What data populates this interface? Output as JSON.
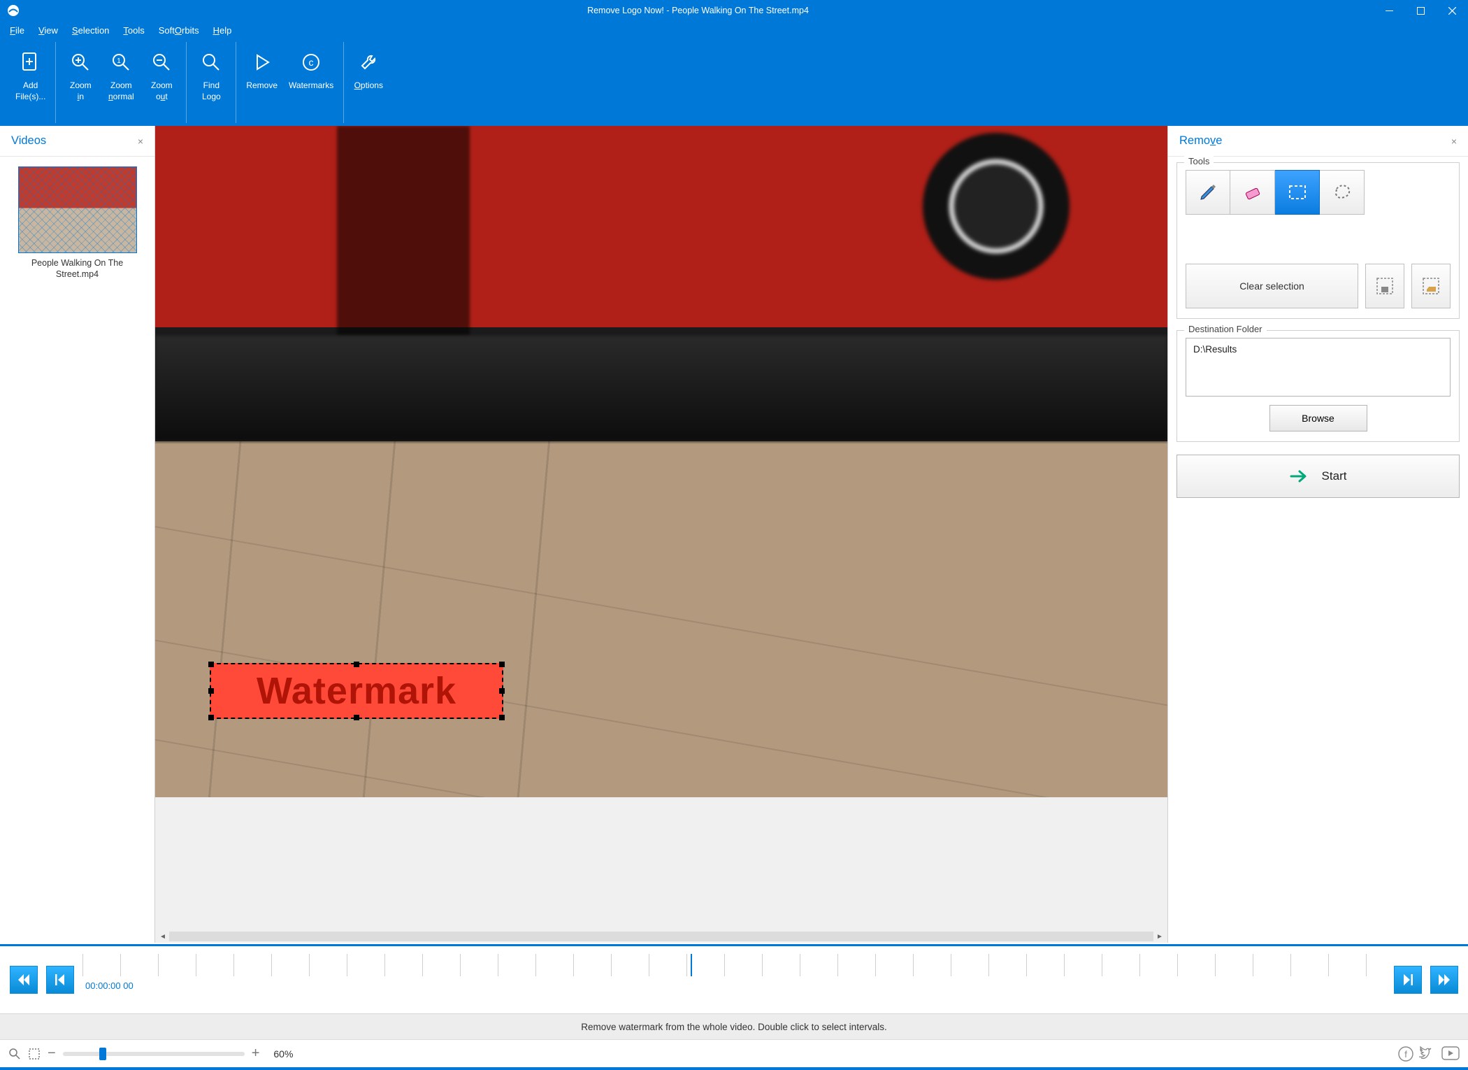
{
  "titlebar": {
    "title": "Remove Logo Now! - People Walking On The Street.mp4"
  },
  "menu": {
    "file": "File",
    "view": "View",
    "selection": "Selection",
    "tools": "Tools",
    "softorbits": "SoftOrbits",
    "help": "Help"
  },
  "ribbon": {
    "add": "Add\nFile(s)...",
    "zoom_in": "Zoom\nin",
    "zoom_normal": "Zoom\nnormal",
    "zoom_out": "Zoom\nout",
    "find_logo": "Find\nLogo",
    "remove": "Remove",
    "watermarks": "Watermarks",
    "options": "Options"
  },
  "left_panel": {
    "title": "Videos",
    "thumb_name": "People Walking On The\nStreet.mp4"
  },
  "canvas": {
    "watermark_text": "Watermark"
  },
  "right_panel": {
    "title": "Remove",
    "tools_label": "Tools",
    "clear_selection": "Clear selection",
    "dest_label": "Destination Folder",
    "dest_path": "D:\\Results",
    "browse": "Browse",
    "start": "Start"
  },
  "timeline": {
    "timecode": "00:00:00 00"
  },
  "hint": {
    "text": "Remove watermark from the whole video. Double click to select intervals."
  },
  "status": {
    "zoom_pct": "60%"
  }
}
